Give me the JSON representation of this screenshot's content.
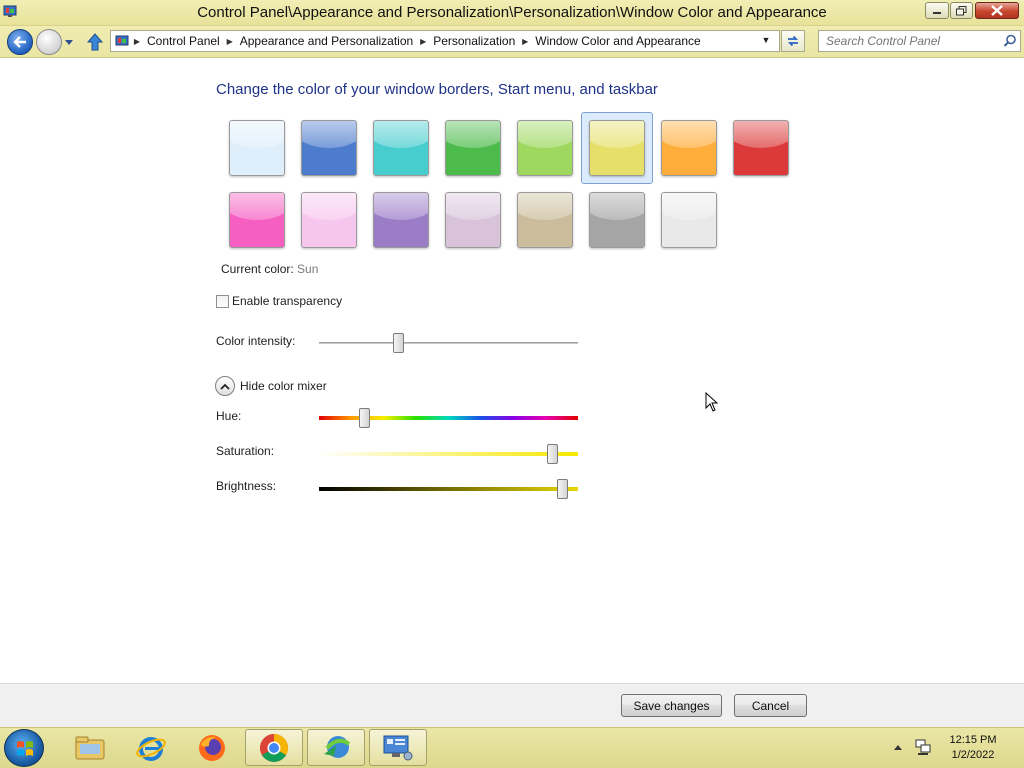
{
  "window": {
    "title": "Control Panel\\Appearance and Personalization\\Personalization\\Window Color and Appearance"
  },
  "addressbar": {
    "crumbs": [
      "Control Panel",
      "Appearance and Personalization",
      "Personalization",
      "Window Color and Appearance"
    ],
    "search_placeholder": "Search Control Panel"
  },
  "content": {
    "heading": "Change the color of your window borders, Start menu, and taskbar",
    "swatches": [
      {
        "color": "#dfeefb",
        "selected": false
      },
      {
        "color": "#4d7ccd",
        "selected": false
      },
      {
        "color": "#48cdcf",
        "selected": false
      },
      {
        "color": "#4cbb4c",
        "selected": false
      },
      {
        "color": "#9ed85f",
        "selected": false
      },
      {
        "color": "#e6e06a",
        "selected": true
      },
      {
        "color": "#ffae3c",
        "selected": false
      },
      {
        "color": "#dc3a3a",
        "selected": false
      },
      {
        "color": "#f65fc2",
        "selected": false
      },
      {
        "color": "#f7c6ee",
        "selected": false
      },
      {
        "color": "#9a7cc7",
        "selected": false
      },
      {
        "color": "#d8c3db",
        "selected": false
      },
      {
        "color": "#cbbd9c",
        "selected": false
      },
      {
        "color": "#a5a5a5",
        "selected": false
      },
      {
        "color": "#e9e9e9",
        "selected": false
      }
    ],
    "current_color_label": "Current color:",
    "current_color_value": "Sun",
    "transparency_label": "Enable transparency",
    "transparency_checked": false,
    "intensity_label": "Color intensity:",
    "intensity_value": 0.3,
    "mixer_toggle_label": "Hide color mixer",
    "hue_label": "Hue:",
    "hue_value": 0.16,
    "saturation_label": "Saturation:",
    "saturation_value": 0.92,
    "brightness_label": "Brightness:",
    "brightness_value": 0.96
  },
  "footer": {
    "save_label": "Save changes",
    "cancel_label": "Cancel"
  },
  "taskbar": {
    "items": [
      "file-explorer-icon",
      "internet-explorer-icon",
      "firefox-icon",
      "chrome-icon",
      "download-manager-icon",
      "control-panel-icon"
    ],
    "time": "12:15 PM",
    "date": "1/2/2022"
  }
}
